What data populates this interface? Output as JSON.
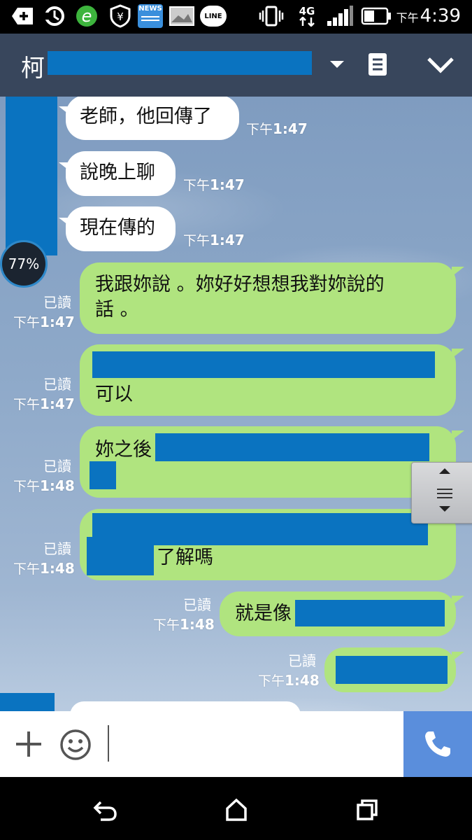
{
  "status_bar": {
    "time_prefix": "下午",
    "time": "4:39",
    "network": "4G",
    "icons": [
      "add-icon",
      "sync-icon",
      "browser-e-icon",
      "shield-yen-icon",
      "news-app-icon",
      "gallery-icon",
      "line-app-icon",
      "vibrate-icon",
      "network-4g-icon",
      "signal-icon",
      "battery-icon"
    ],
    "news_label": "NEWS",
    "line_label": "LINE"
  },
  "header": {
    "title": "柯",
    "colors": {
      "bar": "#38465c",
      "redaction": "#0a73c0"
    }
  },
  "battery_badge": "77%",
  "messages": [
    {
      "direction": "in",
      "text": "老師，他回傳了",
      "time_prefix": "下午",
      "time": "1:47"
    },
    {
      "direction": "in",
      "text": "說晚上聊",
      "time_prefix": "下午",
      "time": "1:47"
    },
    {
      "direction": "in",
      "text": "現在傳的",
      "time_prefix": "下午",
      "time": "1:47"
    },
    {
      "direction": "out",
      "lines": [
        "我跟妳說 。妳好好想想我對妳說的",
        "話 。"
      ],
      "read": "已讀",
      "time_prefix": "下午",
      "time": "1:47"
    },
    {
      "direction": "out",
      "text": "可以",
      "read": "已讀",
      "time_prefix": "下午",
      "time": "1:47"
    },
    {
      "direction": "out",
      "text": "妳之後",
      "read": "已讀",
      "time_prefix": "下午",
      "time": "1:48"
    },
    {
      "direction": "out",
      "text": "了解嗎",
      "read": "已讀",
      "time_prefix": "下午",
      "time": "1:48"
    },
    {
      "direction": "out",
      "text": "就是像",
      "read": "已讀",
      "time_prefix": "下午",
      "time": "1:48"
    },
    {
      "direction": "out",
      "text": "",
      "read": "已讀",
      "time_prefix": "下午",
      "time": "1:48"
    }
  ],
  "input_bar": {
    "placeholder": "",
    "colors": {
      "call_button": "#5a8edc"
    }
  },
  "colors": {
    "outgoing_bubble": "#b0e47f",
    "incoming_bubble": "#ffffff"
  }
}
